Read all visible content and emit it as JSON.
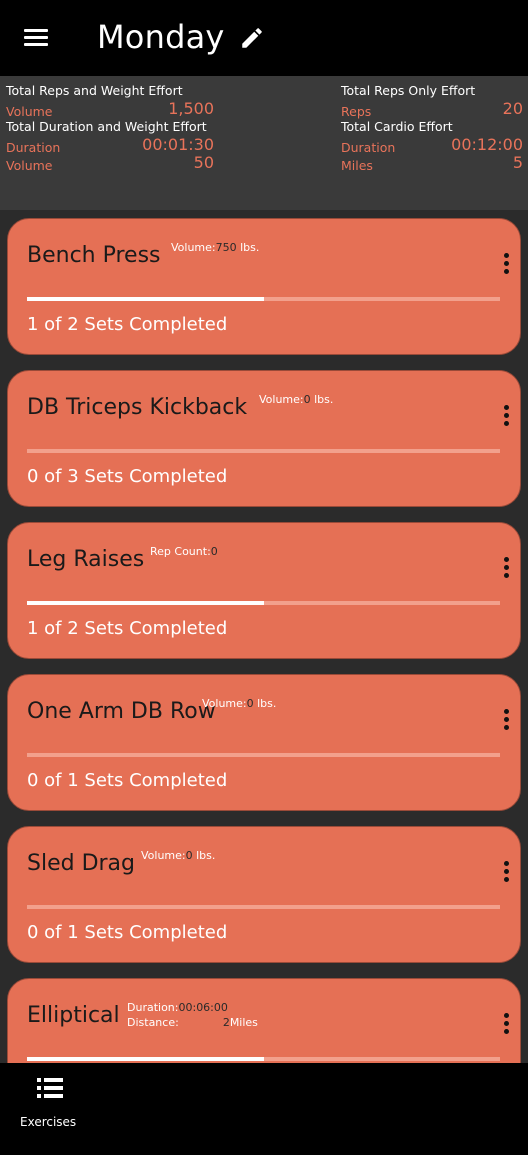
{
  "header": {
    "title": "Monday",
    "icons": {
      "menu": "menu-icon",
      "edit": "pencil-icon"
    }
  },
  "summary": {
    "reps_weight": {
      "heading": "Total Reps and Weight Effort",
      "volume_label": "Volume",
      "volume_value": "1,500"
    },
    "reps_only": {
      "heading": "Total Reps Only Effort",
      "reps_label": "Reps",
      "reps_value": "20"
    },
    "duration_weight": {
      "heading": "Total Duration and Weight Effort",
      "duration_label": "Duration",
      "duration_value": "00:01:30",
      "volume_label": "Volume",
      "volume_value": "50"
    },
    "cardio": {
      "heading": "Total Cardio Effort",
      "duration_label": "Duration",
      "duration_value": "00:12:00",
      "miles_label": "Miles",
      "miles_value": "5"
    }
  },
  "exercises": [
    {
      "name": "Bench Press",
      "stat_label": "Volume:",
      "stat_value": "750",
      "stat_unit": " lbs.",
      "progress": 0.5,
      "sets": "1 of 2 Sets Completed"
    },
    {
      "name": "DB Triceps Kickback",
      "stat_label": "Volume:",
      "stat_value": "0",
      "stat_unit": " lbs.",
      "progress": 0,
      "sets": "0 of 3 Sets Completed"
    },
    {
      "name": "Leg Raises",
      "stat_label": "Rep Count:",
      "stat_value": "0",
      "stat_unit": "",
      "progress": 0.5,
      "sets": "1 of 2 Sets Completed"
    },
    {
      "name": "One Arm DB Row",
      "stat_label": "Volume:",
      "stat_value": "0",
      "stat_unit": " lbs.",
      "progress": 0,
      "sets": "0 of 1 Sets Completed"
    },
    {
      "name": "Sled Drag",
      "stat_label": "Volume:",
      "stat_value": "0",
      "stat_unit": " lbs.",
      "progress": 0,
      "sets": "0 of 1 Sets Completed"
    },
    {
      "name": "Elliptical",
      "stat_label": "Duration:",
      "stat_value": "00:06:00",
      "stat2_label": "Distance:",
      "stat2_value": "2",
      "stat2_unit": "Miles",
      "progress": 0.5,
      "sets": ""
    }
  ],
  "bottom_nav": {
    "label": "Exercises",
    "icon": "list-icon"
  },
  "colors": {
    "accent": "#e57055",
    "summary_bg": "#3a3a3a",
    "list_bg": "#2b2b2b",
    "bar_bg": "#000000"
  }
}
